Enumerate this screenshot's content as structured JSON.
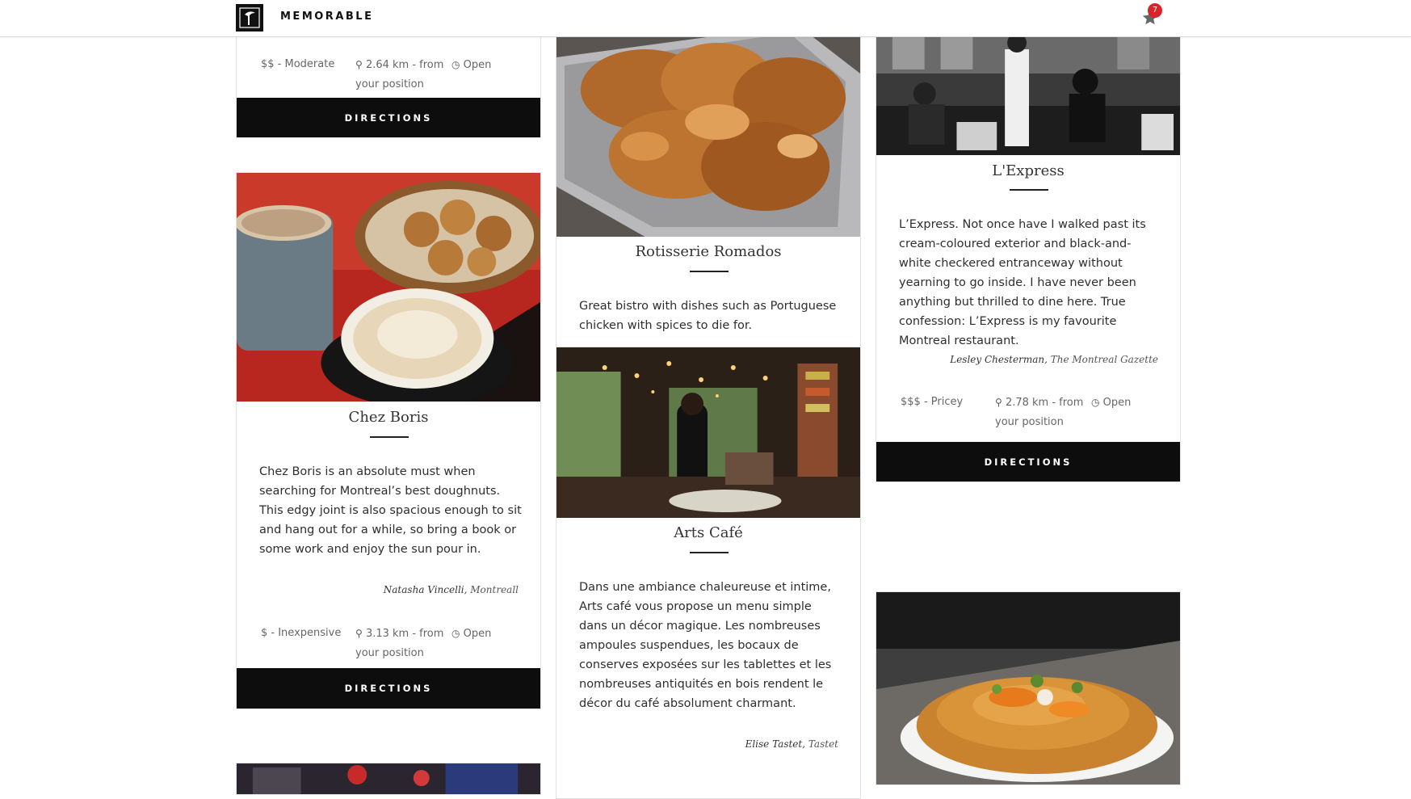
{
  "header": {
    "brand": "MEMORABLE",
    "favorites_count": "7"
  },
  "cards": {
    "top_left": {
      "price": "$$ - Moderate",
      "distance": "2.64 km - from",
      "distance_cont": "your position",
      "status": "Open",
      "button": "DIRECTIONS"
    },
    "chez_boris": {
      "title": "Chez Boris",
      "description": "Chez Boris is an absolute must when searching for Montreal’s best doughnuts. This edgy joint is also spacious enough to sit and hang out for a while, so bring a book or some work and enjoy the sun pour in.",
      "author": "Natasha Vincelli",
      "source": "Montreall",
      "price": "$ - Inexpensive",
      "distance": "3.13 km - from",
      "distance_cont": "your position",
      "status": "Open",
      "button": "DIRECTIONS"
    },
    "rotisserie": {
      "title": "Rotisserie Romados",
      "description": "Great bistro with dishes such as Portuguese chicken with spices to die for."
    },
    "arts_cafe": {
      "title": "Arts Café",
      "description": "Dans une ambiance chaleureuse et intime, Arts café vous propose un menu simple dans un décor magique. Les nombreuses ampoules suspendues, les bocaux de conserves exposées sur les tablettes et les nombreuses antiquités en bois rendent le décor du café absolument charmant.",
      "author": "Elise Tastet",
      "source": "Tastet"
    },
    "lexpress": {
      "title": "L'Express",
      "description": "L’Express. Not once have I walked past its cream-coloured exterior and black-and-white checkered entranceway without yearning to go inside. I have never been anything but thrilled to dine here. True confession: L’Express is my favourite Montreal restaurant.",
      "author": "Lesley Chesterman",
      "source": "The Montreal Gazette",
      "price": "$$$ - Pricey",
      "distance": "2.78 km - from",
      "distance_cont": "your position",
      "status": "Open",
      "button": "DIRECTIONS"
    }
  },
  "icons": {
    "map_marker": "map-marker-icon",
    "clock": "clock-icon",
    "star": "star-icon"
  },
  "colors": {
    "button_bg": "#0d0d0d",
    "badge": "#d9232a"
  }
}
